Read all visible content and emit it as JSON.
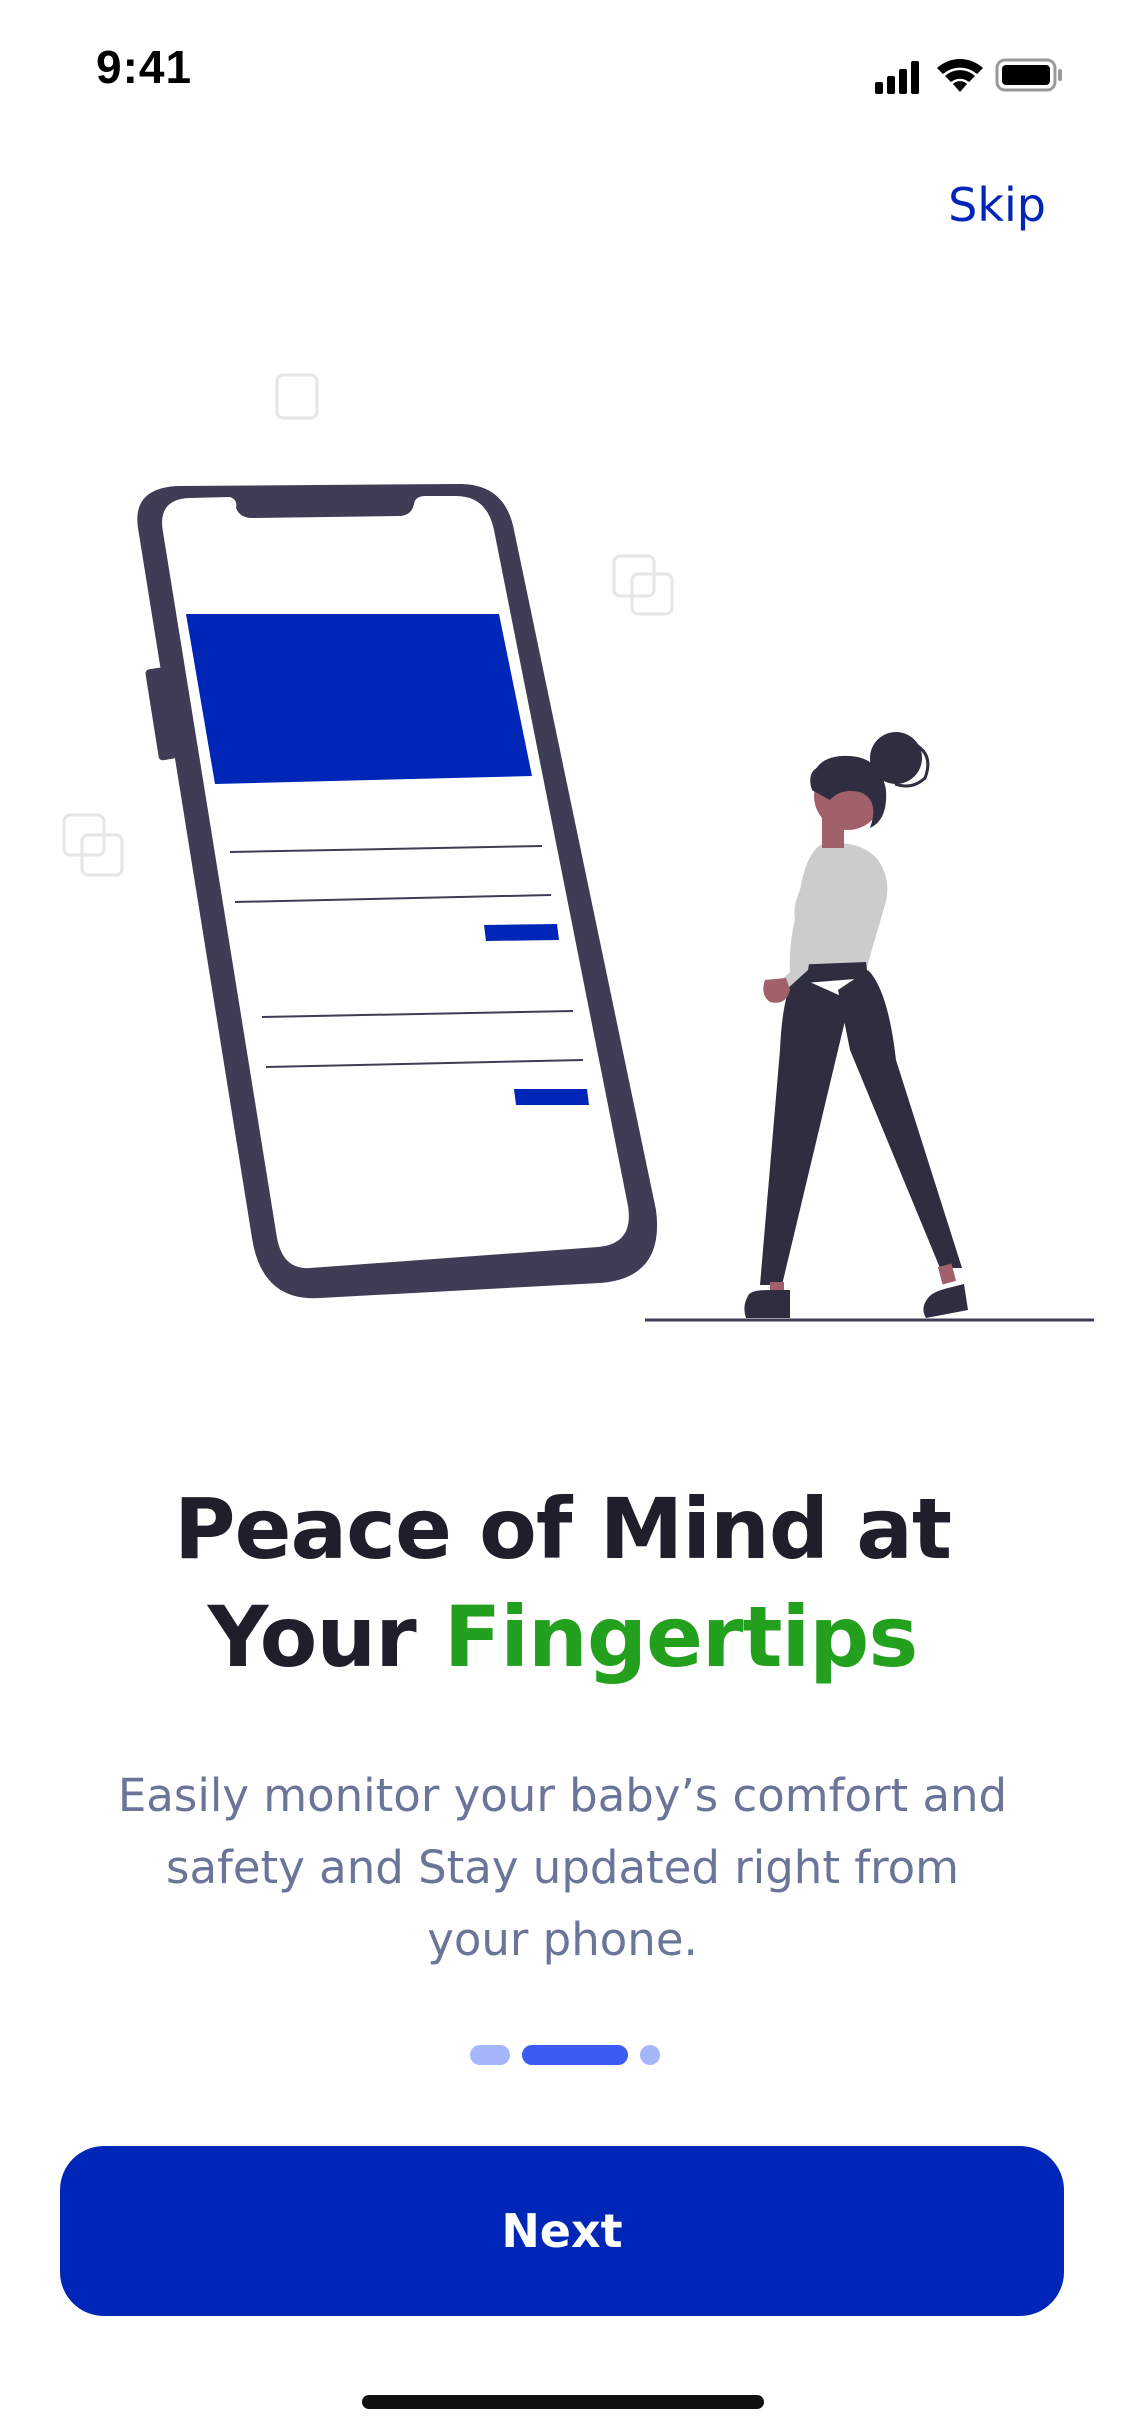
{
  "status_bar": {
    "time": "9:41",
    "icons": [
      "signal-icon",
      "wifi-icon",
      "battery-icon"
    ]
  },
  "skip_label": "Skip",
  "headline": {
    "line1": "Peace of Mind at",
    "line2_prefix": "Your ",
    "line2_accent": "Fingertips"
  },
  "subtitle": "Easily monitor your baby’s comfort and safety and Stay updated right from your phone.",
  "pagination": {
    "total": 3,
    "active_index": 1
  },
  "next_label": "Next",
  "colors": {
    "primary": "#0026b8",
    "accent_green": "#24a01f",
    "headline": "#1e1f2b",
    "subtitle": "#6b7599",
    "dot_active": "#3b5bf2",
    "dot_inactive": "#a6b6fb",
    "phone_frame": "#3f3d56",
    "skin": "#a0616a",
    "shirt": "#cccccc",
    "pants": "#2f2e41"
  }
}
